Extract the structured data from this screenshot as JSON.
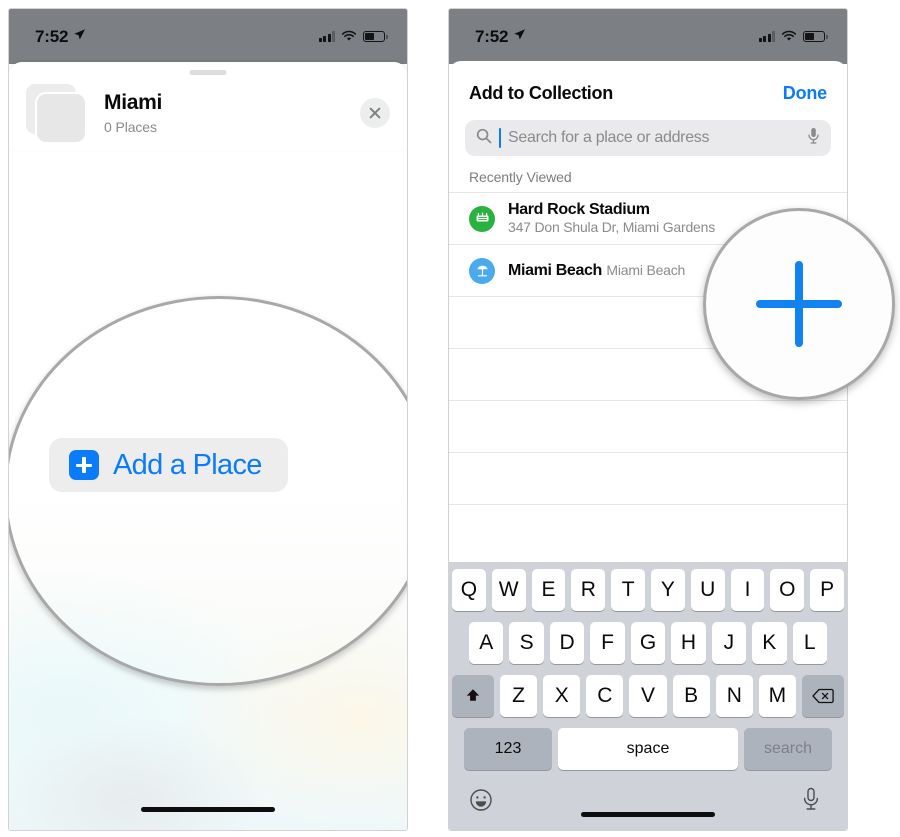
{
  "status_bar": {
    "time": "7:52",
    "location_arrow_icon": "location-arrow-icon",
    "signal_icon": "cellular-signal-icon",
    "wifi_icon": "wifi-icon",
    "battery_icon": "battery-icon"
  },
  "colors": {
    "accent_blue": "#0a7cfb",
    "status_bar_bg": "#7c8084",
    "keyboard_bg": "#cfd2d8",
    "stadium_green": "#27b33e",
    "beach_blue": "#4aaaf0",
    "pill_gray": "#ededed"
  },
  "left_phone": {
    "collection": {
      "title": "Miami",
      "subtitle": "0 Places",
      "thumbnail_icon": "collection-thumbnail-stack-icon",
      "close_icon": "close-icon"
    },
    "add_place": {
      "label": "Add a Place",
      "icon": "plus-square-icon"
    },
    "grabber_icon": "sheet-grabber-icon",
    "home_indicator_icon": "home-indicator-icon"
  },
  "right_phone": {
    "sheet": {
      "title": "Add to Collection",
      "done_label": "Done"
    },
    "search": {
      "placeholder": "Search for a place or address",
      "value": "",
      "search_icon": "search-icon",
      "mic_icon": "microphone-icon"
    },
    "section_header": "Recently Viewed",
    "results": [
      {
        "title": "Hard Rock Stadium",
        "subtitle": "347 Don Shula Dr, Miami Gardens",
        "icon": "stadium-icon"
      },
      {
        "title": "Miami Beach",
        "subtitle": "Miami Beach",
        "icon": "beach-umbrella-icon"
      }
    ],
    "magnifier": {
      "icon": "plus-icon"
    },
    "keyboard": {
      "row1": [
        "Q",
        "W",
        "E",
        "R",
        "T",
        "Y",
        "U",
        "I",
        "O",
        "P"
      ],
      "row2": [
        "A",
        "S",
        "D",
        "F",
        "G",
        "H",
        "J",
        "K",
        "L"
      ],
      "row3": [
        "Z",
        "X",
        "C",
        "V",
        "B",
        "N",
        "M"
      ],
      "shift_icon": "shift-icon",
      "delete_icon": "delete-backspace-icon",
      "numeric_label": "123",
      "space_label": "space",
      "return_label": "search",
      "emoji_icon": "emoji-smiley-icon",
      "dictation_icon": "microphone-icon",
      "home_indicator_icon": "home-indicator-icon"
    }
  }
}
